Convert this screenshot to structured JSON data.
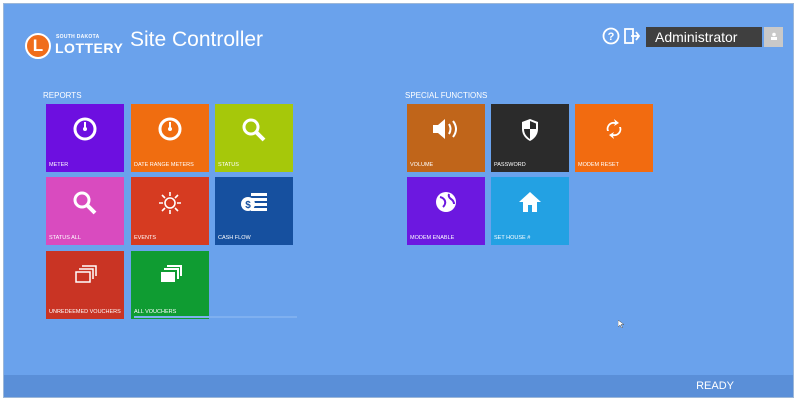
{
  "header": {
    "logo_small": "SOUTH DAKOTA",
    "logo_main": "LOTTERY",
    "logo_glyph": "L",
    "title": "Site Controller",
    "user": "Administrator"
  },
  "reports": {
    "label": "REPORTS",
    "tiles": [
      {
        "id": "meter",
        "label": "METER",
        "color": "#6d0fe0",
        "icon": "gauge-icon"
      },
      {
        "id": "date-range-meters",
        "label": "DATE RANGE METERS",
        "color": "#f06d10",
        "icon": "gauge-icon"
      },
      {
        "id": "status",
        "label": "STATUS",
        "color": "#a6c80a",
        "icon": "search-icon"
      },
      {
        "id": "status-all",
        "label": "STATUS ALL",
        "color": "#d94bbf",
        "icon": "search-icon"
      },
      {
        "id": "events",
        "label": "EVENTS",
        "color": "#d63b21",
        "icon": "sun-icon"
      },
      {
        "id": "cash-flow",
        "label": "CASH FLOW",
        "color": "#16509f",
        "icon": "cash-icon"
      },
      {
        "id": "unredeemed-vouchers",
        "label": "UNREDEEMED VOUCHERS",
        "color": "#c93424",
        "icon": "vouchers-icon"
      },
      {
        "id": "all-vouchers",
        "label": "ALL VOUCHERS",
        "color": "#0f9c32",
        "icon": "vouchers-icon"
      }
    ]
  },
  "special": {
    "label": "SPECIAL FUNCTIONS",
    "tiles": [
      {
        "id": "volume",
        "label": "VOLUME",
        "color": "#c0651a",
        "icon": "speaker-icon"
      },
      {
        "id": "password",
        "label": "PASSWORD",
        "color": "#2b2b2b",
        "icon": "shield-icon"
      },
      {
        "id": "modem-reset",
        "label": "MODEM RESET",
        "color": "#f26b10",
        "icon": "refresh-icon"
      },
      {
        "id": "modem-enable",
        "label": "MODEM ENABLE",
        "color": "#6c18e0",
        "icon": "globe-icon"
      },
      {
        "id": "set-house",
        "label": "SET HOUSE #",
        "color": "#23a1e3",
        "icon": "home-icon"
      }
    ]
  },
  "status": {
    "text": "READY"
  }
}
